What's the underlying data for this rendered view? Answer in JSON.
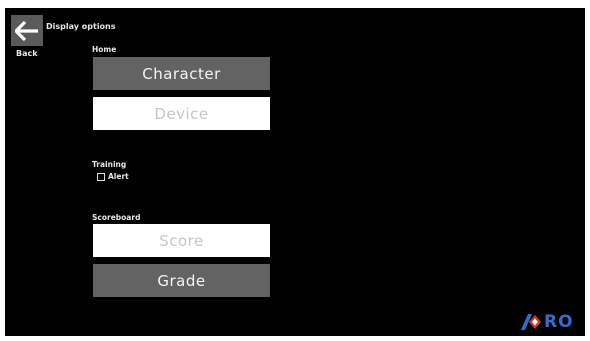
{
  "header": {
    "title": "Display options",
    "back_label": "Back"
  },
  "home": {
    "label": "Home",
    "buttons": [
      {
        "label": "Character",
        "state": "selected"
      },
      {
        "label": "Device",
        "state": "unselected"
      }
    ]
  },
  "training": {
    "label": "Training",
    "alert": {
      "label": "Alert",
      "checked": false
    }
  },
  "scoreboard": {
    "label": "Scoreboard",
    "buttons": [
      {
        "label": "Score",
        "state": "unselected"
      },
      {
        "label": "Grade",
        "state": "selected"
      }
    ]
  },
  "logo": {
    "text": "RO",
    "icon": "logo-icon",
    "colors": {
      "blue": "#2f6fd0",
      "red": "#d8342c"
    }
  },
  "colors": {
    "background": "#000000",
    "button_selected": "#636363",
    "button_unselected": "#ffffff"
  }
}
